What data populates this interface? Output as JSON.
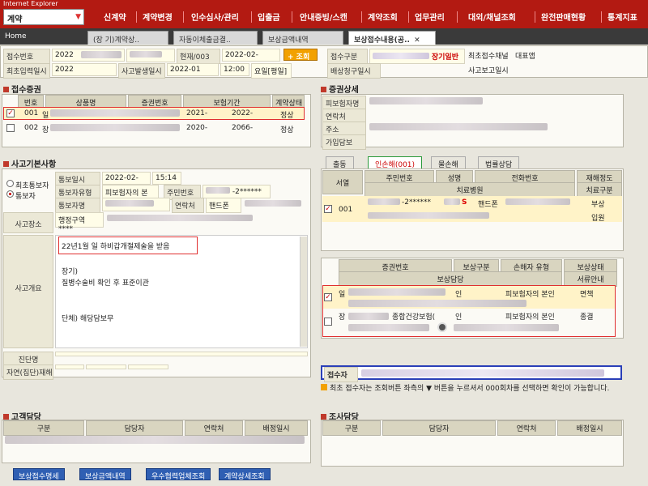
{
  "app": {
    "window_title": "Internet Explorer",
    "selector": "계약"
  },
  "menu": [
    "신계약",
    "계약변경",
    "인수심사/관리",
    "입출금",
    "안내증빙/스캔",
    "계약조회",
    "업무관리",
    "대외/채널조회",
    "완전판매현황",
    "통계지표"
  ],
  "tabs": [
    "Home",
    "(장 기)계약상..",
    "자동이체출금결..",
    "보상금액내역",
    "보상접수내용(공.."
  ],
  "reception": {
    "no_label": "접수번호",
    "no_value": "2022",
    "current_label": "현재/003",
    "current_value": "2022-02-",
    "search_btn": "+ 조회",
    "type_label": "접수구분",
    "type_value": "장기일반",
    "channel_label": "최초접수채널",
    "channel_value": "대표앱",
    "first_date_label": "최초입력일시",
    "first_date_value": "2022",
    "accident_date_label": "사고발생일시",
    "accident_date_value": "2022-01",
    "accident_time": "12:00",
    "day_label": "요일[평일]",
    "claim_label": "배상청구일시",
    "report_label": "사고보고일시"
  },
  "policy_section": {
    "title": "접수증권",
    "headers": [
      "번호",
      "상품명",
      "증권번호",
      "보험기간",
      "",
      "계약상태"
    ],
    "rows": [
      {
        "checked": true,
        "no": "001",
        "name_prefix": "일",
        "start": "2021-",
        "end": "2022-",
        "status": "정상"
      },
      {
        "checked": false,
        "no": "002",
        "name_prefix": "장",
        "start": "2020-",
        "end": "2066-",
        "status": "정상"
      }
    ]
  },
  "policy_detail": {
    "title": "증권상세",
    "rows": [
      "피보험자명",
      "연락처",
      "주소",
      "가입담보"
    ]
  },
  "accident_section": {
    "title": "사고기본사항",
    "radio_first": "최초통보자",
    "radio_reporter": "통보자",
    "report_date_label": "통보일시",
    "report_date_value": "2022-02-",
    "report_time": "15:14",
    "reporter_type_label": "통보자유형",
    "reporter_type_value": "피보험자의 본",
    "ssn_label": "주민번호",
    "ssn_value": "-2******",
    "reporter_name_label": "통보자명",
    "contact_label": "연락처",
    "contact_value": "핸드폰",
    "place_label": "사고장소",
    "place_value": "행정구역",
    "place_mask": "****",
    "summary_label": "사고개요",
    "summary_line1": "22년1월  일 하비갑개절제술을 받음",
    "summary_line2": "장기)",
    "summary_line3": "질병수술비 확인 후 표준이관",
    "summary_line4": "단체) 해당담보무",
    "diagnosis_label": "진단명",
    "disaster_label": "자연(집단)재해"
  },
  "damage_tabs": [
    "출동",
    "인손해(001)",
    "물손해",
    "법률상담"
  ],
  "damage_table": {
    "headers": [
      "서열",
      "주민번호",
      "성명",
      "전화번호",
      "재해정도",
      "치료병원",
      "치료구분"
    ],
    "row": {
      "no": "001",
      "ssn": "-2******",
      "name": "S",
      "phone": "핸드폰",
      "severity": "부상",
      "treatment": "입원"
    }
  },
  "handling_table": {
    "headers": [
      "증권번호",
      "보상구분",
      "손해자 유형",
      "보상상태",
      "보상담당",
      "서류안내"
    ],
    "rows": [
      {
        "checked": true,
        "prefix": "일",
        "type": "인",
        "owner": "피보험자의 본인",
        "status": "면책"
      },
      {
        "checked": false,
        "prefix": "장",
        "product": "종합건강보험(",
        "type": "인",
        "owner": "피보험자의 본인",
        "status": "종결"
      }
    ]
  },
  "receiver": {
    "label": "접수자",
    "note": "최초 접수자는 조회버튼 좌측의 ▼ 버튼을 누르셔서 000회차를 선택하면 확인이 가능합니다."
  },
  "customer_section": {
    "title": "고객담당",
    "headers": [
      "구분",
      "담당자",
      "연락처",
      "배정일시"
    ]
  },
  "investigation_section": {
    "title": "조사담당",
    "headers": [
      "구분",
      "담당자",
      "연락처",
      "배정일시"
    ]
  },
  "bottom_buttons": [
    "보상접수명세",
    "보상금액내역",
    "우수협력업체조회",
    "계약상세조회"
  ],
  "colors": {
    "brand": "#b31a12",
    "highlight": "#e03030",
    "button_blue": "#2f5fb3"
  }
}
